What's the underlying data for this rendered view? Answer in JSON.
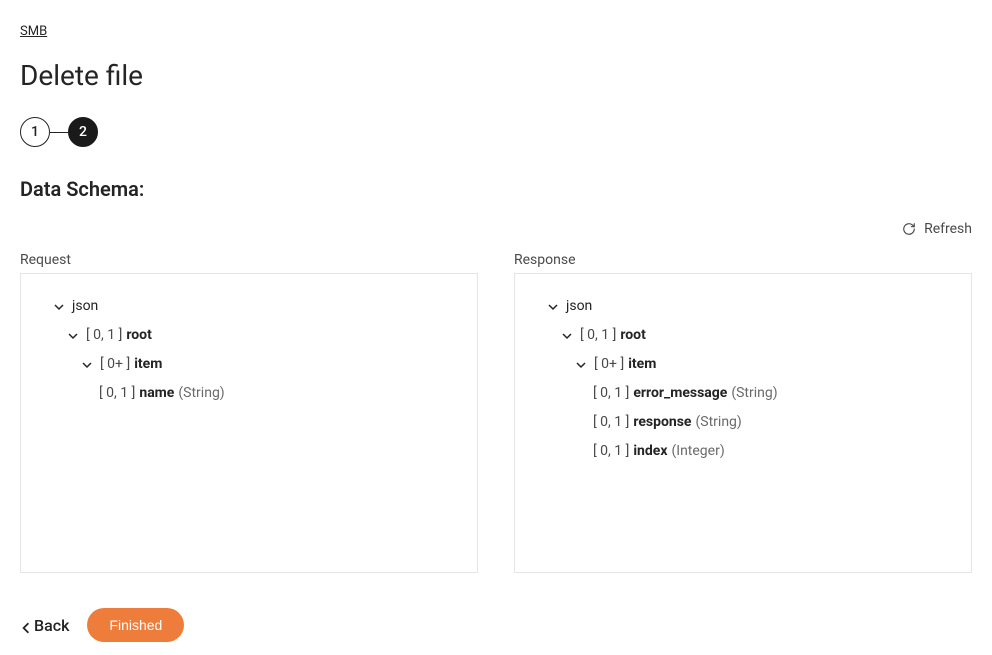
{
  "breadcrumb": {
    "label": "SMB"
  },
  "page_title": "Delete file",
  "stepper": {
    "steps": [
      "1",
      "2"
    ],
    "active_index": 1
  },
  "section_title": "Data Schema:",
  "refresh_label": "Refresh",
  "request": {
    "label": "Request",
    "tree": {
      "root_label": "json",
      "root": {
        "card": "[ 0, 1 ]",
        "name": "root"
      },
      "item": {
        "card": "[ 0+ ]",
        "name": "item"
      },
      "fields": [
        {
          "card": "[ 0, 1 ]",
          "name": "name",
          "type": "(String)"
        }
      ]
    }
  },
  "response": {
    "label": "Response",
    "tree": {
      "root_label": "json",
      "root": {
        "card": "[ 0, 1 ]",
        "name": "root"
      },
      "item": {
        "card": "[ 0+ ]",
        "name": "item"
      },
      "fields": [
        {
          "card": "[ 0, 1 ]",
          "name": "error_message",
          "type": "(String)"
        },
        {
          "card": "[ 0, 1 ]",
          "name": "response",
          "type": "(String)"
        },
        {
          "card": "[ 0, 1 ]",
          "name": "index",
          "type": "(Integer)"
        }
      ]
    }
  },
  "footer": {
    "back_label": "Back",
    "finished_label": "Finished"
  }
}
